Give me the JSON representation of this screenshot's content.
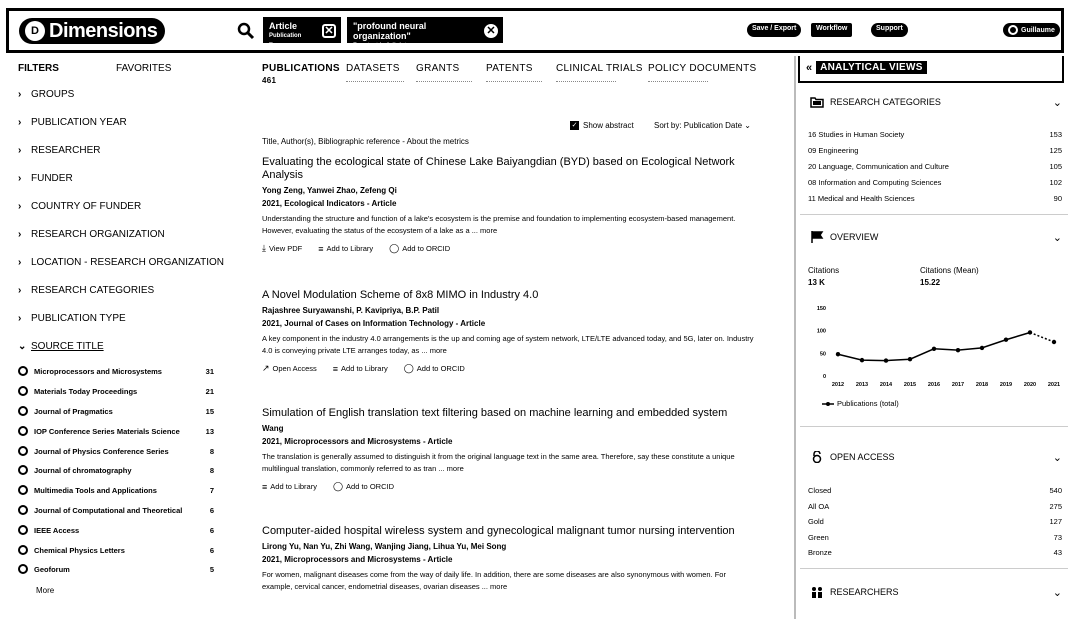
{
  "header": {
    "logo_text": "Dimensions",
    "chips": [
      {
        "main": "Article",
        "sub": "Publication Type"
      },
      {
        "main": "\"profound neural organization\"",
        "sub": "Free text in full data"
      }
    ],
    "save_export": "Save / Export",
    "workflow": "Workflow",
    "support": "Support",
    "user": "Guillaume"
  },
  "filters": {
    "title": "FILTERS",
    "favorites": "FAVORITES",
    "groups": [
      "GROUPS",
      "PUBLICATION YEAR",
      "RESEARCHER",
      "FUNDER",
      "COUNTRY OF FUNDER",
      "RESEARCH ORGANIZATION",
      "LOCATION - RESEARCH ORGANIZATION",
      "RESEARCH CATEGORIES",
      "PUBLICATION TYPE"
    ],
    "source_title": "SOURCE TITLE",
    "sources": [
      {
        "name": "Microprocessors and Microsystems",
        "count": "31"
      },
      {
        "name": "Materials Today Proceedings",
        "count": "21"
      },
      {
        "name": "Journal of Pragmatics",
        "count": "15"
      },
      {
        "name": "IOP Conference Series Materials Science",
        "count": "13"
      },
      {
        "name": "Journal of Physics Conference Series",
        "count": "8"
      },
      {
        "name": "Journal of chromatography",
        "count": "8"
      },
      {
        "name": "Multimedia Tools and Applications",
        "count": "7"
      },
      {
        "name": "Journal of Computational and Theoretical",
        "count": "6"
      },
      {
        "name": "IEEE Access",
        "count": "6"
      },
      {
        "name": "Chemical Physics Letters",
        "count": "6"
      },
      {
        "name": "Geoforum",
        "count": "5"
      }
    ],
    "more": "More"
  },
  "tabs": [
    {
      "label": "PUBLICATIONS",
      "count": "461"
    },
    {
      "label": "DATASETS",
      "count": ""
    },
    {
      "label": "GRANTS",
      "count": ""
    },
    {
      "label": "PATENTS",
      "count": ""
    },
    {
      "label": "CLINICAL TRIALS",
      "count": ""
    },
    {
      "label": "POLICY DOCUMENTS",
      "count": ""
    }
  ],
  "toolbar": {
    "show_abstract": "Show abstract",
    "sort_by": "Sort by: Publication Date",
    "column_header": "Title, Author(s), Bibliographic reference - About the metrics"
  },
  "publications": [
    {
      "title": "Evaluating the ecological state of Chinese Lake Baiyangdian (BYD) based on Ecological Network Analysis",
      "authors": "Yong Zeng, Yanwei Zhao, Zefeng Qi",
      "source": "2021, Ecological Indicators - Article",
      "abstract": "Understanding the structure and function of a lake's ecosystem is the premise and foundation to implementing ecosystem-based management. However, evaluating the status of the ecosystem of a lake as a ... more",
      "actions": [
        "View PDF",
        "Add to Library",
        "Add to ORCID"
      ]
    },
    {
      "title": "A Novel Modulation Scheme of 8x8 MIMO in Industry 4.0",
      "authors": "Rajashree Suryawanshi, P. Kavipriya, B.P. Patil",
      "source": "2021, Journal of Cases on Information Technology - Article",
      "abstract": "A key component in the industry 4.0 arrangements is the up and coming age of system network, LTE/LTE advanced today, and 5G, later on. Industry 4.0 is conveying private LTE arranges today, as ... more",
      "actions": [
        "Open Access",
        "Add to Library",
        "Add to ORCID"
      ]
    },
    {
      "title": "Simulation of English translation text filtering based on machine learning and embedded system",
      "authors": "Wang",
      "source": "2021, Microprocessors and Microsystems - Article",
      "abstract": "The translation is generally assumed to distinguish it from the original language text in the same area. Therefore, say these constitute a unique multilingual translation, commonly referred to as tran ... more",
      "actions": [
        "Add to Library",
        "Add to ORCID"
      ]
    },
    {
      "title": "Computer-aided hospital wireless system and gynecological malignant tumor nursing intervention",
      "authors": "Lirong Yu, Nan Yu, Zhi Wang, Wanjing Jiang, Lihua Yu, Mei Song",
      "source": "2021, Microprocessors and Microsystems - Article",
      "abstract": "For women, malignant diseases come from the way of daily life. In addition, there are some diseases are also synonymous with women. For example, cervical cancer, endometrial diseases, ovarian diseases ... more",
      "actions": []
    }
  ],
  "analytics": {
    "title": "ANALYTICAL VIEWS",
    "research_categories": {
      "title": "RESEARCH CATEGORIES",
      "items": [
        {
          "name": "16 Studies in Human Society",
          "count": "153"
        },
        {
          "name": "09 Engineering",
          "count": "125"
        },
        {
          "name": "20 Language, Communication and Culture",
          "count": "105"
        },
        {
          "name": "08 Information and Computing Sciences",
          "count": "102"
        },
        {
          "name": "11 Medical and Health Sciences",
          "count": "90"
        }
      ]
    },
    "overview": {
      "title": "OVERVIEW",
      "citations_label": "Citations",
      "citations_value": "13 K",
      "citations_mean_label": "Citations (Mean)",
      "citations_mean_value": "15.22",
      "legend": "Publications (total)"
    },
    "open_access": {
      "title": "OPEN ACCESS",
      "items": [
        {
          "name": "Closed",
          "count": "540"
        },
        {
          "name": "All OA",
          "count": "275"
        },
        {
          "name": "Gold",
          "count": "127"
        },
        {
          "name": "Green",
          "count": "73"
        },
        {
          "name": "Bronze",
          "count": "43"
        }
      ]
    },
    "researchers": {
      "title": "RESEARCHERS"
    }
  },
  "chart_data": {
    "type": "line",
    "x": [
      "2012",
      "2013",
      "2014",
      "2015",
      "2016",
      "2017",
      "2018",
      "2019",
      "2020",
      "2021"
    ],
    "y_ticks": [
      "150",
      "100",
      "50",
      "0"
    ],
    "ylim": [
      0,
      150
    ],
    "series": [
      {
        "name": "Publications (total)",
        "values": [
          48,
          35,
          34,
          37,
          60,
          57,
          62,
          80,
          96,
          75
        ],
        "dashed_last_segment": true
      }
    ],
    "grid": false,
    "legend": "bottom-left"
  }
}
